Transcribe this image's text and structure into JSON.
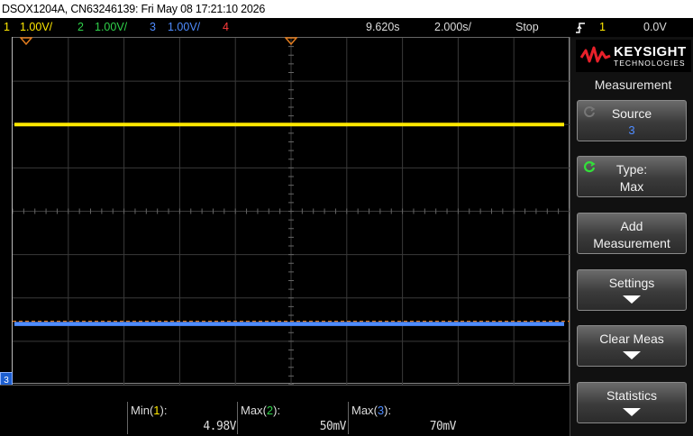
{
  "title_bar": {
    "text": "DSOX1204A, CN63246139: Fri May 08 17:21:10 2026"
  },
  "status_bar": {
    "channels": [
      {
        "number": "1",
        "scale": "1.00V/"
      },
      {
        "number": "2",
        "scale": "1.00V/"
      },
      {
        "number": "3",
        "scale": "1.00V/"
      },
      {
        "number": "4",
        "scale": ""
      }
    ],
    "time_position": "9.620s",
    "time_scale": "2.000s/",
    "run_state": "Stop",
    "trigger_channel": "1",
    "trigger_level": "0.0V"
  },
  "colors": {
    "ch1": "#ffe800",
    "ch2": "#2fd24a",
    "ch3": "#4f8cff",
    "ch4": "#ff3b3b",
    "trigger_marker": "#e07b1e"
  },
  "waveform": {
    "ch1_level_divisions": 2.0,
    "ch3_level_divisions": -2.6,
    "trigger_level_divisions": -2.6
  },
  "ground_marker": {
    "label": "3"
  },
  "measurements": [
    {
      "name": "Min",
      "channel": "1",
      "value": "4.98V"
    },
    {
      "name": "Max",
      "channel": "2",
      "value": "50mV"
    },
    {
      "name": "Max",
      "channel": "3",
      "value": "70mV"
    }
  ],
  "logo": {
    "word": "KEYSIGHT",
    "sub": "TECHNOLOGIES"
  },
  "menu": {
    "title": "Measurement",
    "softkeys": [
      {
        "line1": "Source",
        "line2": "3",
        "icon": "knob-icon-dim"
      },
      {
        "line1": "Type:",
        "line2": "Max",
        "icon": "knob-icon"
      },
      {
        "line1": "Add",
        "line2": "Measurement"
      },
      {
        "line1": "Settings",
        "icon": "down-arrow-icon"
      },
      {
        "line1": "Clear Meas",
        "icon": "down-arrow-icon"
      },
      {
        "line1": "Statistics",
        "icon": "down-arrow-icon"
      }
    ]
  }
}
